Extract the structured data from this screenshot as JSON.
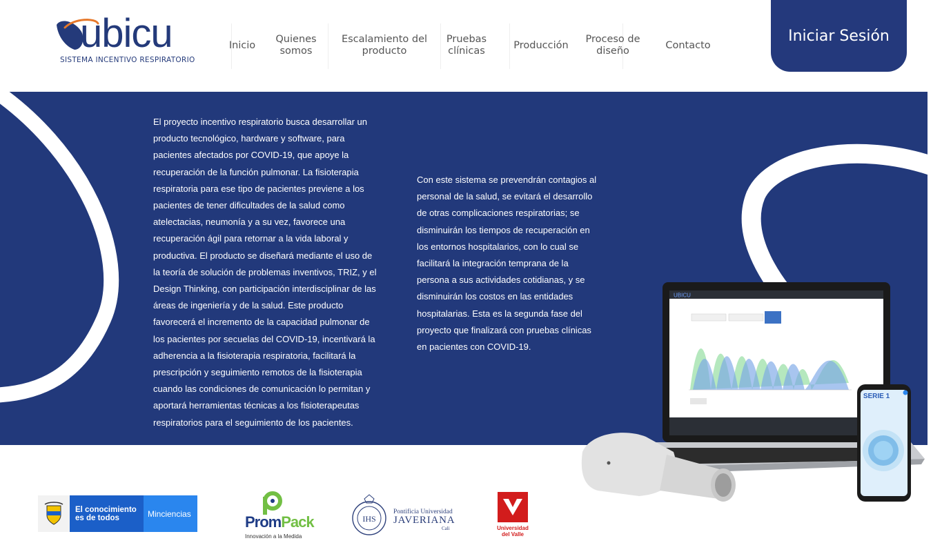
{
  "brand": {
    "name": "ubicu",
    "tagline": "SISTEMA INCENTIVO RESPIRATORIO",
    "primary_color": "#22397b",
    "accent_color": "#e6782a"
  },
  "nav": {
    "items": [
      {
        "label": "Inicio"
      },
      {
        "label": "Quienes somos"
      },
      {
        "label": "Escalamiento del producto"
      },
      {
        "label": "Pruebas clínicas"
      },
      {
        "label": "Producción"
      },
      {
        "label": "Proceso de diseño"
      },
      {
        "label": "Contacto"
      }
    ],
    "login_label": "Iniciar Sesión"
  },
  "hero": {
    "paragraph_1": "El proyecto incentivo respiratorio busca desarrollar un producto tecnológico, hardware y software, para pacientes afectados por COVID-19, que apoye la recuperación de la función pulmonar. La fisioterapia respiratoria para ese tipo de pacientes previene a los pacientes de tener dificultades de la salud como atelectacias, neumonía y a su vez, favorece una recuperación ágil para retornar a la vida laboral y productiva. El producto se diseñará mediante el uso de la teoría de solución de problemas inventivos, TRIZ, y el Design Thinking, con participación interdisciplinar de las áreas de ingeniería y de la salud. Este producto favorecerá el incremento de la capacidad pulmonar de los pacientes por secuelas del COVID-19, incentivará la adherencia a la fisioterapia respiratoria, facilitará la prescripción y seguimiento remotos de la fisioterapia cuando las condiciones de comunicación lo permitan y aportará herramientas técnicas a los fisioterapeutas respiratorios para el seguimiento de los pacientes.",
    "paragraph_2": "Con este sistema se prevendrán contagios al personal de la salud, se evitará el desarrollo de otras complicaciones respiratorias; se disminuirán los tiempos de recuperación en los entornos hospitalarios, con lo cual se facilitará la integración temprana de la persona a sus actividades cotidianas, y se disminuirán los costos en las entidades hospitalarias. Esta es la segunda fase del proyecto que finalizará con pruebas clínicas en pacientes con COVID-19."
  },
  "devices": {
    "phone_title": "SERIE 1",
    "laptop_screen_brand": "UBICU"
  },
  "partners": {
    "gob_line1": "El conocimiento",
    "gob_line2": "es de todos",
    "gob_ministry": "Minciencias",
    "prompack_prom": "Prom",
    "prompack_pack": "Pack",
    "prompack_tag": "Innovación a la Medida",
    "javeriana_line1": "Pontificia Universidad",
    "javeriana_line2": "JAVERIANA",
    "javeriana_city": "Cali",
    "valle_line1": "Universidad",
    "valle_line2": "del Valle"
  }
}
